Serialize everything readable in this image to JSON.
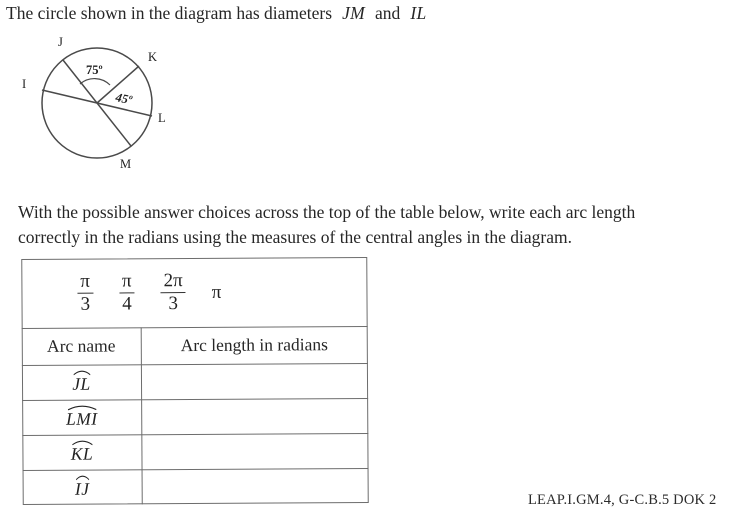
{
  "prompt": {
    "before": "The circle shown in the diagram has diameters",
    "diameter_1": "JM",
    "conjunction": "and",
    "diameter_2": "IL"
  },
  "diagram": {
    "name": "circle-with-diameters",
    "point_labels": [
      "J",
      "K",
      "I",
      "L",
      "M"
    ],
    "angle_1": "75º",
    "angle_2": "45º"
  },
  "instructions": {
    "line_1": "With the possible answer choices across the top of the table below, write each arc length",
    "line_2": "correctly in the radians using the measures of the central angles in the diagram."
  },
  "table": {
    "choices": [
      {
        "type": "fraction",
        "numerator": "π",
        "denominator": "3",
        "text": "π/3"
      },
      {
        "type": "fraction",
        "numerator": "π",
        "denominator": "4",
        "text": "π/4"
      },
      {
        "type": "fraction",
        "numerator": "2π",
        "denominator": "3",
        "text": "2π/3"
      },
      {
        "type": "plain",
        "text": "π"
      }
    ],
    "headers": {
      "arc_name": "Arc name",
      "arc_length": "Arc length in radians"
    },
    "rows": [
      {
        "arc": "JL",
        "answer": ""
      },
      {
        "arc": "LMI",
        "answer": ""
      },
      {
        "arc": "KL",
        "answer": ""
      },
      {
        "arc": "IJ",
        "answer": ""
      }
    ]
  },
  "footer": {
    "standard_code": "LEAP.I.GM.4, G-C.B.5 DOK 2"
  }
}
